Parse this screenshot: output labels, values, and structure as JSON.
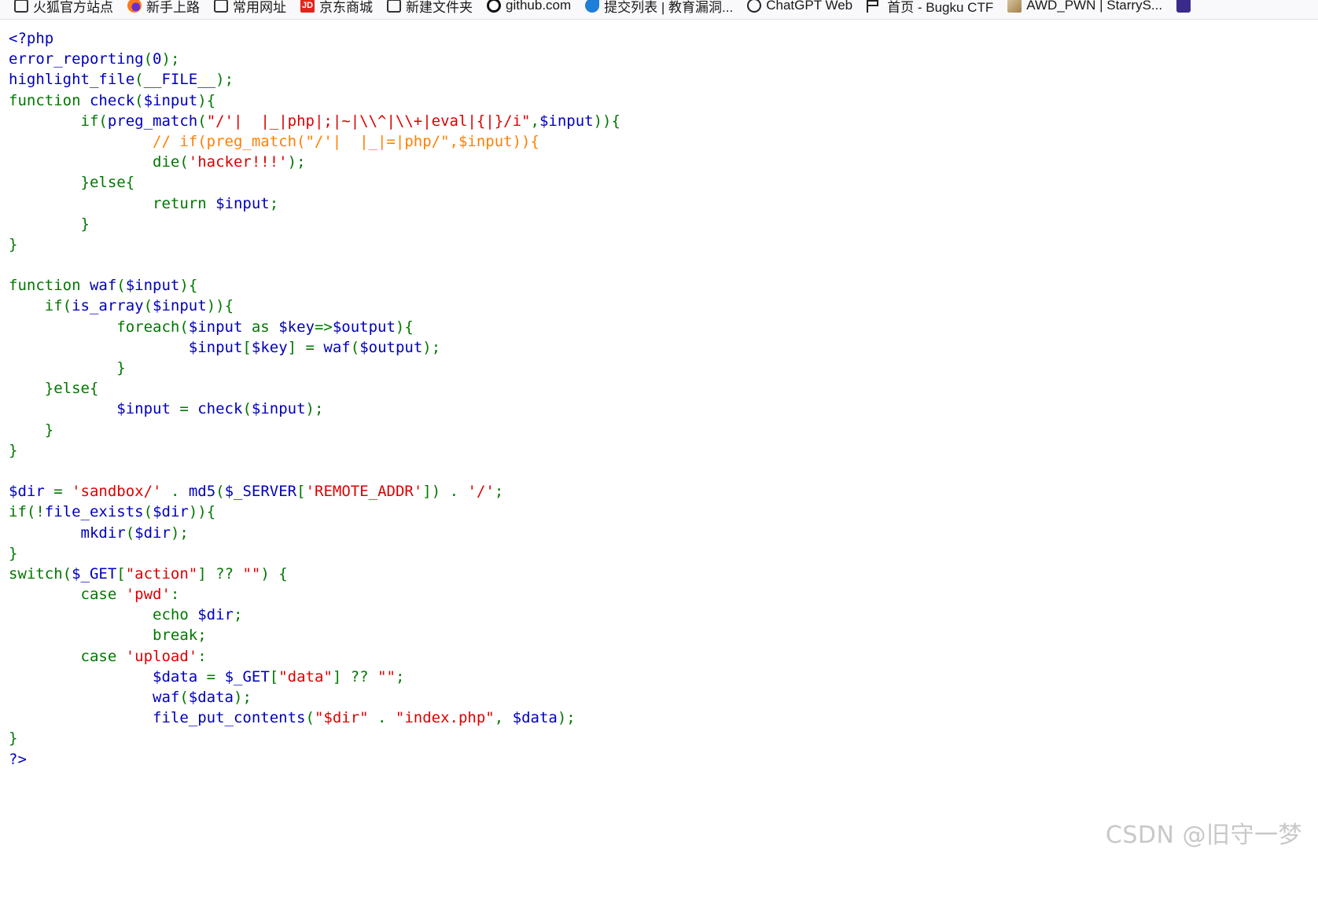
{
  "bookmarks": [
    {
      "icon": "folder-icon",
      "label": "火狐官方站点"
    },
    {
      "icon": "firefox-icon",
      "label": "新手上路"
    },
    {
      "icon": "folder-icon",
      "label": "常用网址"
    },
    {
      "icon": "jd-icon",
      "label": "京东商城"
    },
    {
      "icon": "folder-icon",
      "label": "新建文件夹"
    },
    {
      "icon": "github-icon",
      "label": "github.com"
    },
    {
      "icon": "bird-icon",
      "label": "提交列表 | 教育漏洞..."
    },
    {
      "icon": "chatgpt-icon",
      "label": "ChatGPT Web"
    },
    {
      "icon": "flag-icon",
      "label": "首页 - Bugku CTF"
    },
    {
      "icon": "image-icon",
      "label": "AWD_PWN | StarryS..."
    }
  ],
  "code_lines": [
    [
      [
        "d",
        "<?php"
      ]
    ],
    [
      [
        "d",
        "error_reporting"
      ],
      [
        "k",
        "("
      ],
      [
        "d",
        "0"
      ],
      [
        "k",
        ");"
      ]
    ],
    [
      [
        "d",
        "highlight_file"
      ],
      [
        "k",
        "("
      ],
      [
        "d",
        "__FILE__"
      ],
      [
        "k",
        ");"
      ]
    ],
    [
      [
        "k",
        "function "
      ],
      [
        "d",
        "check"
      ],
      [
        "k",
        "("
      ],
      [
        "d",
        "$input"
      ],
      [
        "k",
        "){"
      ]
    ],
    [
      [
        "k",
        "        if("
      ],
      [
        "d",
        "preg_match"
      ],
      [
        "k",
        "("
      ],
      [
        "s",
        "\"/'|  |_|php|;|~|\\\\^|\\\\+|eval|{|}/i\""
      ],
      [
        "k",
        ","
      ],
      [
        "d",
        "$input"
      ],
      [
        "k",
        "))"
      ],
      [
        "k",
        "{"
      ]
    ],
    [
      [
        "c",
        "                // if(preg_match(\"/'|  |_|=|php/\",$input)){"
      ]
    ],
    [
      [
        "k",
        "                die("
      ],
      [
        "s",
        "'hacker!!!'"
      ],
      [
        "k",
        ");"
      ]
    ],
    [
      [
        "k",
        "        }else{"
      ]
    ],
    [
      [
        "k",
        "                return "
      ],
      [
        "d",
        "$input"
      ],
      [
        "k",
        ";"
      ]
    ],
    [
      [
        "k",
        "        }"
      ]
    ],
    [
      [
        "k",
        "}"
      ]
    ],
    [],
    [
      [
        "k",
        "function "
      ],
      [
        "d",
        "waf"
      ],
      [
        "k",
        "("
      ],
      [
        "d",
        "$input"
      ],
      [
        "k",
        "){"
      ]
    ],
    [
      [
        "k",
        "    if("
      ],
      [
        "d",
        "is_array"
      ],
      [
        "k",
        "("
      ],
      [
        "d",
        "$input"
      ],
      [
        "k",
        "))"
      ],
      [
        "k",
        "{"
      ]
    ],
    [
      [
        "k",
        "            foreach("
      ],
      [
        "d",
        "$input "
      ],
      [
        "k",
        "as "
      ],
      [
        "d",
        "$key"
      ],
      [
        "k",
        "=>"
      ],
      [
        "d",
        "$output"
      ],
      [
        "k",
        "){"
      ]
    ],
    [
      [
        "d",
        "                    $input"
      ],
      [
        "k",
        "["
      ],
      [
        "d",
        "$key"
      ],
      [
        "k",
        "] = "
      ],
      [
        "d",
        "waf"
      ],
      [
        "k",
        "("
      ],
      [
        "d",
        "$output"
      ],
      [
        "k",
        ");"
      ]
    ],
    [
      [
        "k",
        "            }"
      ]
    ],
    [
      [
        "k",
        "    }else{"
      ]
    ],
    [
      [
        "d",
        "            $input "
      ],
      [
        "k",
        "= "
      ],
      [
        "d",
        "check"
      ],
      [
        "k",
        "("
      ],
      [
        "d",
        "$input"
      ],
      [
        "k",
        ");"
      ]
    ],
    [
      [
        "k",
        "    }"
      ]
    ],
    [
      [
        "k",
        "}"
      ]
    ],
    [],
    [
      [
        "d",
        "$dir "
      ],
      [
        "k",
        "= "
      ],
      [
        "s",
        "'sandbox/' "
      ],
      [
        "k",
        ". "
      ],
      [
        "d",
        "md5"
      ],
      [
        "k",
        "("
      ],
      [
        "d",
        "$_SERVER"
      ],
      [
        "k",
        "["
      ],
      [
        "s",
        "'REMOTE_ADDR'"
      ],
      [
        "k",
        "]) . "
      ],
      [
        "s",
        "'/'"
      ],
      [
        "k",
        ";"
      ]
    ],
    [
      [
        "k",
        "if(!"
      ],
      [
        "d",
        "file_exists"
      ],
      [
        "k",
        "("
      ],
      [
        "d",
        "$dir"
      ],
      [
        "k",
        "))"
      ],
      [
        "k",
        "{"
      ]
    ],
    [
      [
        "d",
        "        mkdir"
      ],
      [
        "k",
        "("
      ],
      [
        "d",
        "$dir"
      ],
      [
        "k",
        ");"
      ]
    ],
    [
      [
        "k",
        "}"
      ]
    ],
    [
      [
        "k",
        "switch("
      ],
      [
        "d",
        "$_GET"
      ],
      [
        "k",
        "["
      ],
      [
        "s",
        "\"action\""
      ],
      [
        "k",
        "] ?? "
      ],
      [
        "s",
        "\"\""
      ],
      [
        "k",
        ") {"
      ]
    ],
    [
      [
        "k",
        "        case "
      ],
      [
        "s",
        "'pwd'"
      ],
      [
        "k",
        ":"
      ]
    ],
    [
      [
        "k",
        "                echo "
      ],
      [
        "d",
        "$dir"
      ],
      [
        "k",
        ";"
      ]
    ],
    [
      [
        "k",
        "                break;"
      ]
    ],
    [
      [
        "k",
        "        case "
      ],
      [
        "s",
        "'upload'"
      ],
      [
        "k",
        ":"
      ]
    ],
    [
      [
        "d",
        "                $data "
      ],
      [
        "k",
        "= "
      ],
      [
        "d",
        "$_GET"
      ],
      [
        "k",
        "["
      ],
      [
        "s",
        "\"data\""
      ],
      [
        "k",
        "] ?? "
      ],
      [
        "s",
        "\"\""
      ],
      [
        "k",
        ";"
      ]
    ],
    [
      [
        "d",
        "                waf"
      ],
      [
        "k",
        "("
      ],
      [
        "d",
        "$data"
      ],
      [
        "k",
        ");"
      ]
    ],
    [
      [
        "d",
        "                file_put_contents"
      ],
      [
        "k",
        "("
      ],
      [
        "s",
        "\"$dir\" "
      ],
      [
        "k",
        ". "
      ],
      [
        "s",
        "\"index.php\""
      ],
      [
        "k",
        ", "
      ],
      [
        "d",
        "$data"
      ],
      [
        "k",
        ");"
      ]
    ],
    [
      [
        "k",
        "}"
      ]
    ],
    [
      [
        "d",
        "?>"
      ]
    ]
  ],
  "colors": {
    "default": "#0000BB",
    "keyword": "#007700",
    "string": "#DD0000",
    "comment": "#FF8000"
  },
  "watermark": "CSDN @旧守一梦"
}
